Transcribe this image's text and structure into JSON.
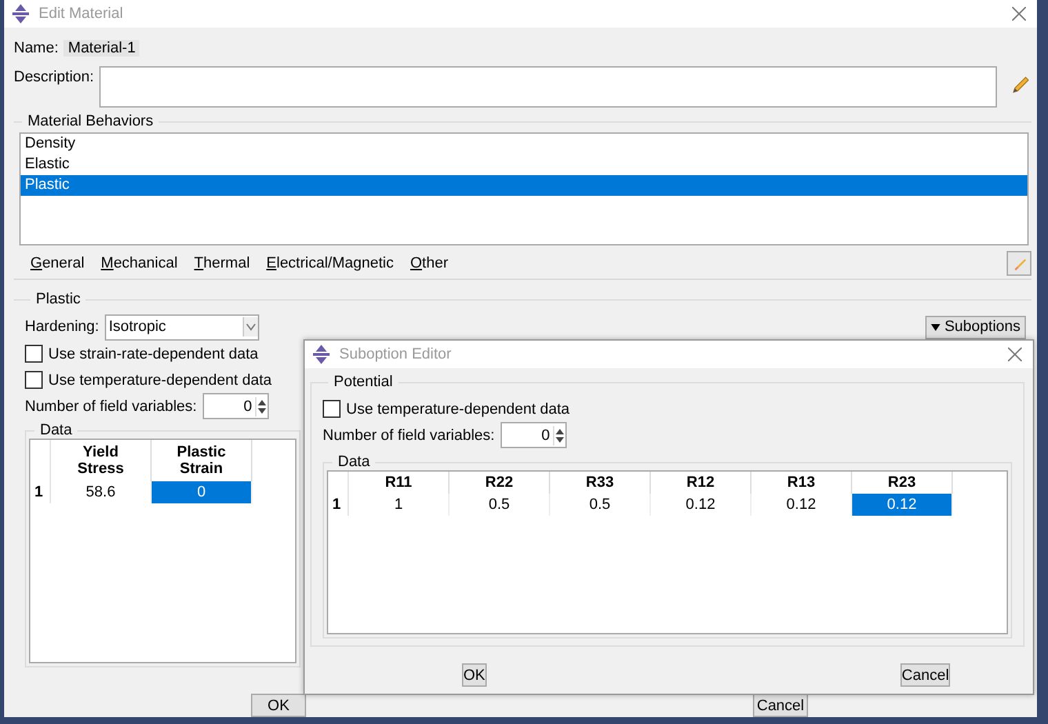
{
  "window": {
    "title": "Edit Material"
  },
  "name": {
    "label": "Name:",
    "value": "Material-1"
  },
  "description": {
    "label": "Description:"
  },
  "material_behaviors": {
    "title": "Material Behaviors",
    "items": [
      {
        "label": "Density",
        "selected": false
      },
      {
        "label": "Elastic",
        "selected": false
      },
      {
        "label": "Plastic",
        "selected": true
      }
    ]
  },
  "menu": [
    "General",
    "Mechanical",
    "Thermal",
    "Electrical/Magnetic",
    "Other"
  ],
  "plastic": {
    "title": "Plastic",
    "hardening": {
      "label": "Hardening:",
      "value": "Isotropic"
    },
    "options": [
      {
        "label": "Use strain-rate-dependent data",
        "checked": false
      },
      {
        "label": "Use temperature-dependent data",
        "checked": false
      }
    ],
    "field_variables": {
      "label": "Number of field variables:",
      "value": "0"
    },
    "suboptions_button": "Suboptions",
    "data": {
      "title": "Data",
      "columns": [
        "Yield Stress",
        "Plastic Strain"
      ],
      "rows": [
        {
          "index": "1",
          "cells": [
            {
              "value": "58.6",
              "selected": false
            },
            {
              "value": "0",
              "selected": true
            }
          ]
        }
      ]
    }
  },
  "buttons": [
    "OK",
    "Cancel"
  ],
  "suboption_editor": {
    "title": "Suboption Editor",
    "potential": {
      "title": "Potential",
      "options": [
        {
          "label": "Use temperature-dependent data",
          "checked": false
        }
      ],
      "field_variables": {
        "label": "Number of field variables:",
        "value": "0"
      },
      "data": {
        "title": "Data",
        "columns": [
          "R11",
          "R22",
          "R33",
          "R12",
          "R13",
          "R23"
        ],
        "rows": [
          {
            "index": "1",
            "cells": [
              {
                "value": "1",
                "selected": false
              },
              {
                "value": "0.5",
                "selected": false
              },
              {
                "value": "0.5",
                "selected": false
              },
              {
                "value": "0.12",
                "selected": false
              },
              {
                "value": "0.12",
                "selected": false
              },
              {
                "value": "0.12",
                "selected": true
              }
            ]
          }
        ]
      }
    },
    "buttons": [
      "OK",
      "Cancel"
    ]
  }
}
